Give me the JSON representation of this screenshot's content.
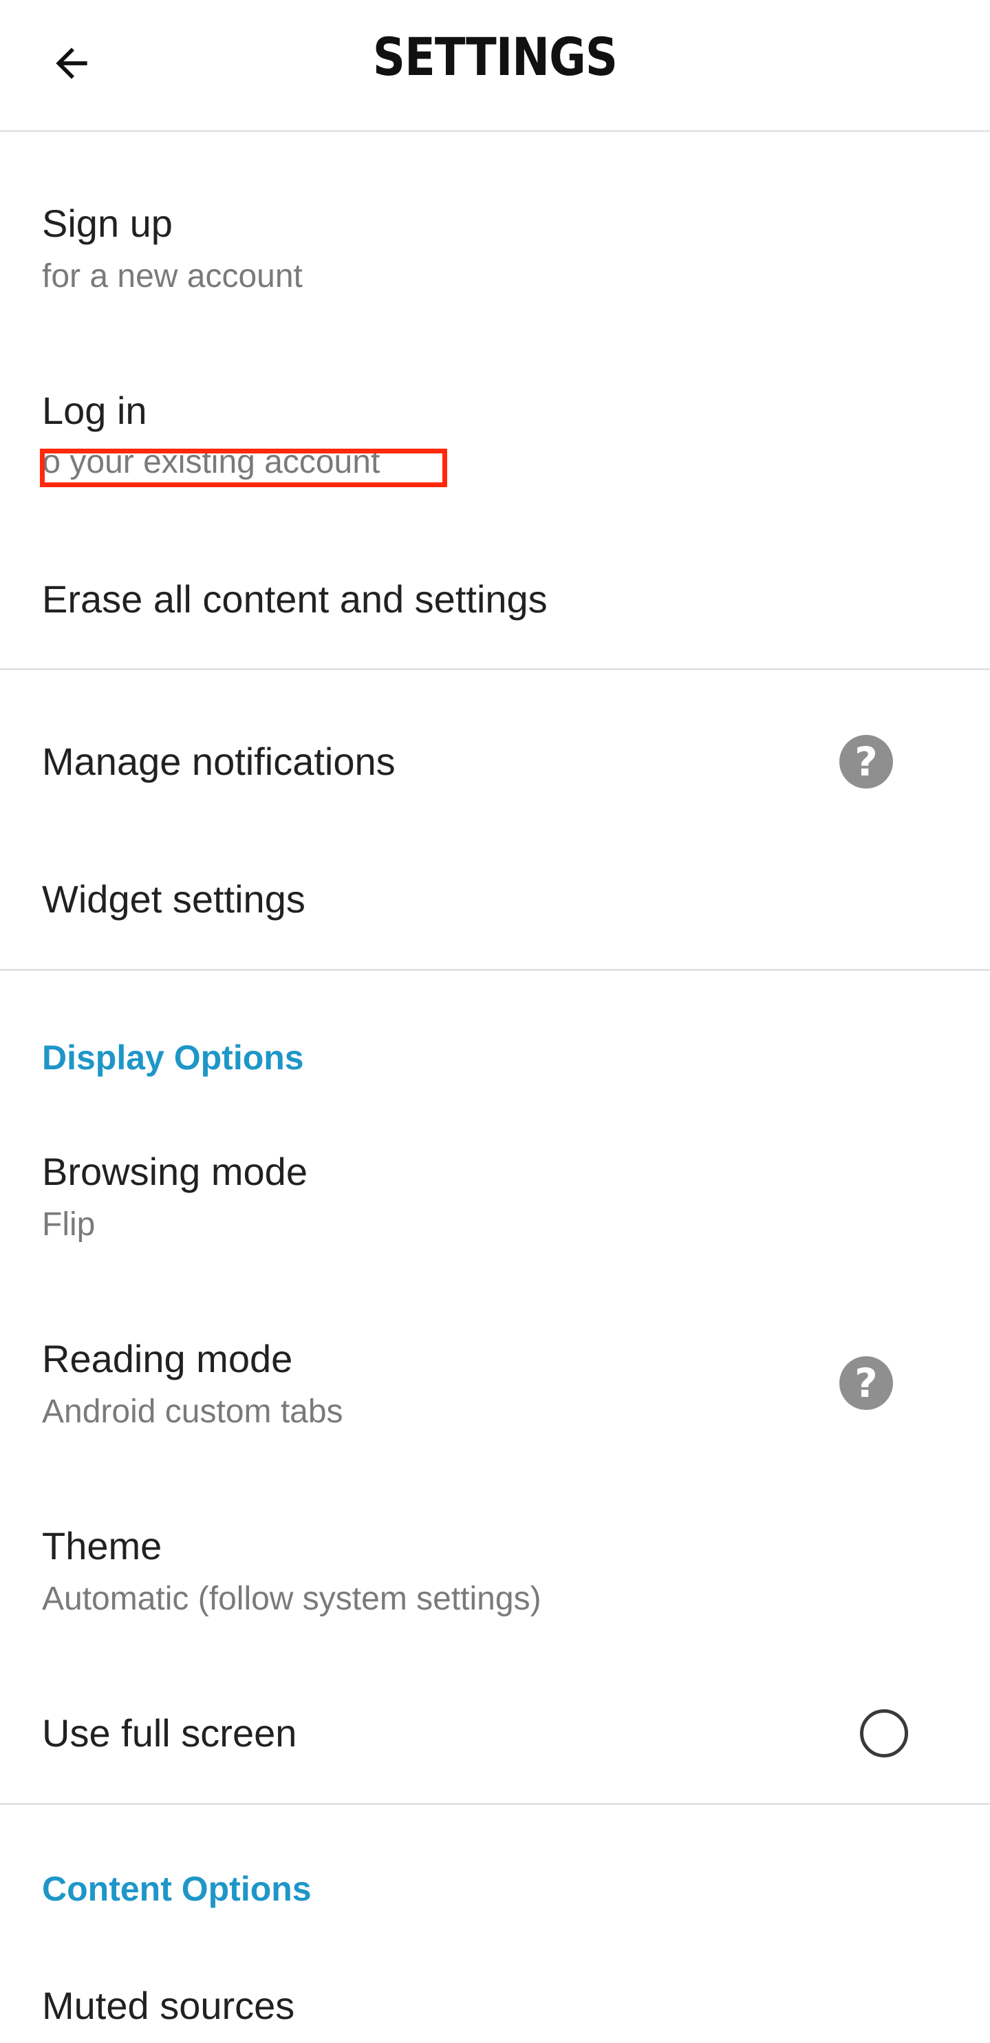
{
  "header": {
    "title": "SETTINGS",
    "back_icon": "arrow-left-icon"
  },
  "account": {
    "signup": {
      "title": "Sign up",
      "subtitle": "for a new account"
    },
    "login": {
      "title": "Log in",
      "subtitle": "to your existing account"
    },
    "erase": {
      "title": "Erase all content and settings"
    }
  },
  "notifications": {
    "manage": {
      "title": "Manage notifications",
      "help_icon": "help-icon",
      "help_glyph": "?"
    },
    "widget": {
      "title": "Widget settings"
    }
  },
  "display": {
    "header": "Display Options",
    "browsing": {
      "title": "Browsing mode",
      "subtitle": "Flip"
    },
    "reading": {
      "title": "Reading mode",
      "subtitle": "Android custom tabs",
      "help_glyph": "?"
    },
    "theme": {
      "title": "Theme",
      "subtitle": "Automatic (follow system settings)"
    },
    "fullscreen": {
      "title": "Use full screen",
      "checked": false
    }
  },
  "content": {
    "header": "Content Options",
    "muted": {
      "title": "Muted sources"
    }
  },
  "colors": {
    "accent": "#1e96c8",
    "highlight": "#ff2a0e",
    "help_icon_bg": "#8f8f8f"
  }
}
